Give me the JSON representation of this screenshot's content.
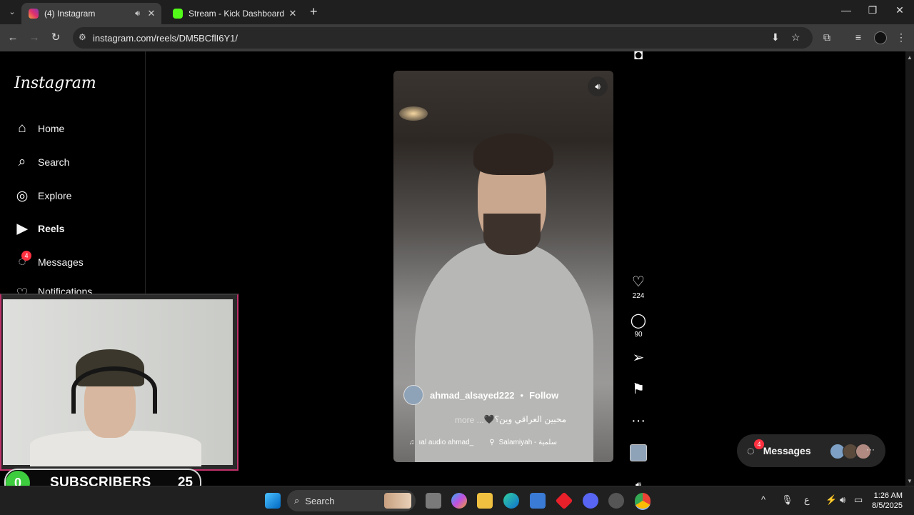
{
  "browser": {
    "tabs": [
      {
        "title": "(4) Instagram",
        "favicon_color": "#e1306c",
        "active": true
      },
      {
        "title": "Stream - Kick Dashboard",
        "favicon_color": "#53fc18",
        "active": false
      }
    ],
    "url": "instagram.com/reels/DM5BCflI6Y1/"
  },
  "sidebar": {
    "logo": "Instagram",
    "items": [
      {
        "label": "Home",
        "icon": "home-icon"
      },
      {
        "label": "Search",
        "icon": "search-icon"
      },
      {
        "label": "Explore",
        "icon": "compass-icon"
      },
      {
        "label": "Reels",
        "icon": "reels-icon"
      },
      {
        "label": "Messages",
        "icon": "messenger-icon",
        "badge": "4"
      },
      {
        "label": "Notifications",
        "icon": "heart-icon"
      }
    ]
  },
  "reel": {
    "author": "ahmad_alsayed222",
    "separator": "•",
    "follow_label": "Follow",
    "caption": "محبين العراقي وين؟🖤",
    "more_label": "more ...",
    "audio": "ıal audio  ahmad_",
    "location": "Salamiyah - سلمية"
  },
  "actions": {
    "likes": "224",
    "comments": "90"
  },
  "messages_pill": {
    "label": "Messages",
    "badge": "4"
  },
  "overlay": {
    "subscribers_label": "SUBSCRIBERS",
    "left_count": "0",
    "right_count": "25"
  },
  "taskbar": {
    "search_label": "Search",
    "time": "1:26 AM",
    "date": "8/5/2025",
    "lang": "ع"
  }
}
